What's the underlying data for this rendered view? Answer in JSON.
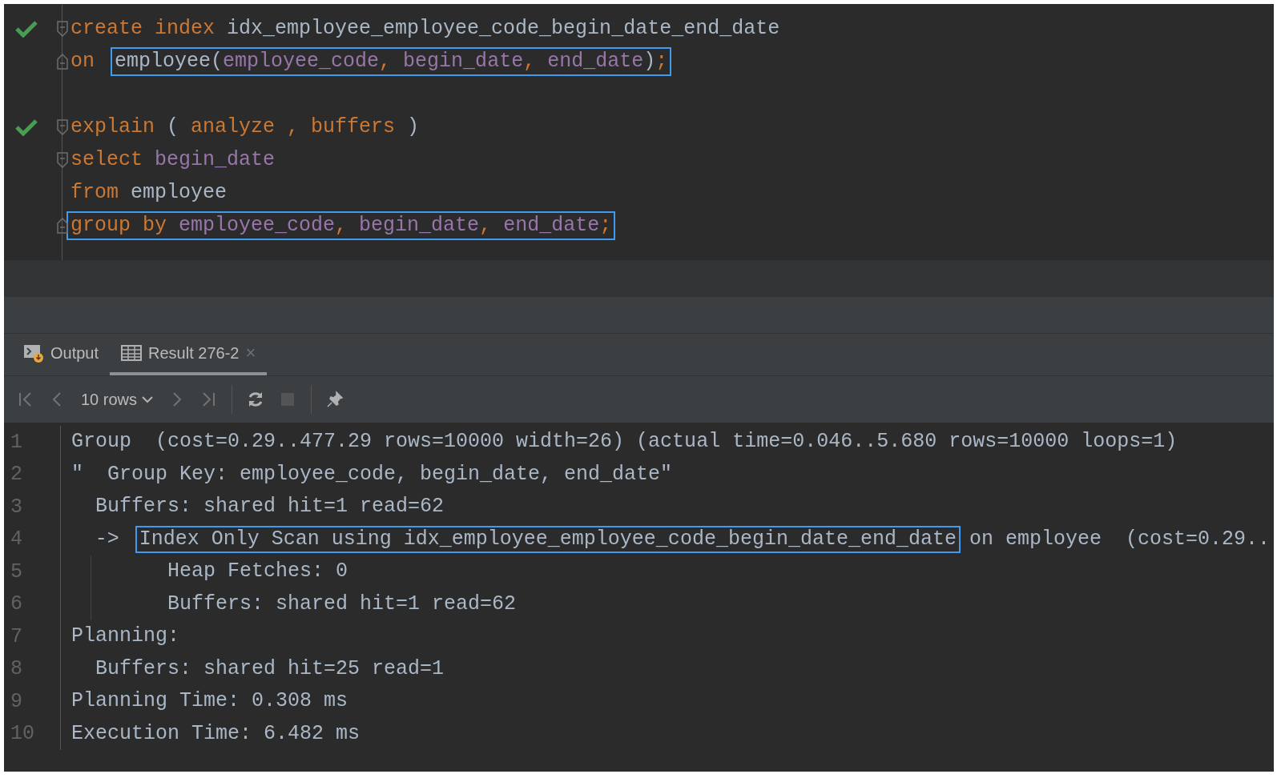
{
  "editor": {
    "lines": [
      {
        "check": true,
        "kind": "fold-start",
        "segments": [
          {
            "highlighted": false,
            "tokens": [
              {
                "kind": "keyword",
                "text": "create index "
              },
              {
                "kind": "name",
                "text": "idx_employee_employee_code_begin_date_end_date"
              }
            ]
          }
        ]
      },
      {
        "check": false,
        "kind": "fold-end",
        "segments": [
          {
            "highlighted": false,
            "tokens": [
              {
                "kind": "keyword",
                "text": "on "
              }
            ]
          },
          {
            "highlighted": true,
            "tokens": [
              {
                "kind": "name",
                "text": "employee("
              },
              {
                "kind": "column",
                "text": "employee_code"
              },
              {
                "kind": "keyword",
                "text": ", "
              },
              {
                "kind": "column",
                "text": "begin_date"
              },
              {
                "kind": "keyword",
                "text": ", "
              },
              {
                "kind": "column",
                "text": "end_date"
              },
              {
                "kind": "name",
                "text": ")"
              },
              {
                "kind": "keyword",
                "text": ";"
              }
            ]
          }
        ]
      },
      {
        "check": false,
        "kind": "plain"
      },
      {
        "check": true,
        "kind": "fold-start",
        "segments": [
          {
            "highlighted": false,
            "tokens": [
              {
                "kind": "keyword",
                "text": "explain "
              },
              {
                "kind": "name",
                "text": "( "
              },
              {
                "kind": "keyword",
                "text": "analyze , buffers "
              },
              {
                "kind": "name",
                "text": ")"
              }
            ]
          }
        ]
      },
      {
        "check": false,
        "kind": "fold-start",
        "segments": [
          {
            "highlighted": false,
            "tokens": [
              {
                "kind": "keyword",
                "text": "select "
              },
              {
                "kind": "column",
                "text": "begin_date"
              }
            ]
          }
        ]
      },
      {
        "check": false,
        "kind": "plain",
        "segments": [
          {
            "highlighted": false,
            "tokens": [
              {
                "kind": "keyword",
                "text": "from "
              },
              {
                "kind": "name",
                "text": "employee"
              }
            ]
          }
        ]
      },
      {
        "check": false,
        "kind": "fold-end",
        "segments": [
          {
            "highlighted": true,
            "tokens": [
              {
                "kind": "keyword",
                "text": "group by "
              },
              {
                "kind": "column",
                "text": "employee_code"
              },
              {
                "kind": "keyword",
                "text": ", "
              },
              {
                "kind": "column",
                "text": "begin_date"
              },
              {
                "kind": "keyword",
                "text": ", "
              },
              {
                "kind": "column",
                "text": "end_date"
              },
              {
                "kind": "keyword",
                "text": ";"
              }
            ]
          }
        ]
      }
    ]
  },
  "tabs": [
    {
      "label": "Output",
      "kind": "output",
      "selected": false
    },
    {
      "label": "Result 276-2",
      "kind": "result",
      "selected": true,
      "close": "×"
    }
  ],
  "toolbar": [
    {
      "kind": "first",
      "disabled": true
    },
    {
      "kind": "prev",
      "disabled": true
    },
    {
      "kind": "rows",
      "label": "10 rows",
      "disabled": false
    },
    {
      "kind": "next",
      "disabled": true
    },
    {
      "kind": "last",
      "disabled": true
    },
    {
      "kind": "separator"
    },
    {
      "kind": "refresh",
      "disabled": false
    },
    {
      "kind": "stop",
      "disabled": true
    },
    {
      "kind": "separator"
    },
    {
      "kind": "pin",
      "disabled": false
    }
  ],
  "results": {
    "rows": [
      {
        "number": "1",
        "guide": false,
        "segments": [
          {
            "highlighted": false,
            "text": "Group  (cost=0.29..477.29 rows=10000 width=26) (actual time=0.046..5.680 rows=10000 loops=1)"
          }
        ]
      },
      {
        "number": "2",
        "guide": false,
        "segments": [
          {
            "highlighted": false,
            "text": "\"  Group Key: employee_code, begin_date, end_date\""
          }
        ]
      },
      {
        "number": "3",
        "guide": false,
        "segments": [
          {
            "highlighted": false,
            "text": "  Buffers: shared hit=1 read=62"
          }
        ]
      },
      {
        "number": "4",
        "guide": false,
        "segments": [
          {
            "highlighted": false,
            "text": "  -> "
          },
          {
            "highlighted": true,
            "text": "Index Only Scan using idx_employee_employee_code_begin_date_end_date"
          },
          {
            "highlighted": false,
            "text": "on employee  (cost=0.29.."
          }
        ]
      },
      {
        "number": "5",
        "guide": true,
        "segments": [
          {
            "highlighted": false,
            "text": "        Heap Fetches: 0"
          }
        ]
      },
      {
        "number": "6",
        "guide": true,
        "segments": [
          {
            "highlighted": false,
            "text": "        Buffers: shared hit=1 read=62"
          }
        ]
      },
      {
        "number": "7",
        "guide": false,
        "segments": [
          {
            "highlighted": false,
            "text": "Planning:"
          }
        ]
      },
      {
        "number": "8",
        "guide": false,
        "segments": [
          {
            "highlighted": false,
            "text": "  Buffers: shared hit=25 read=1"
          }
        ]
      },
      {
        "number": "9",
        "guide": false,
        "segments": [
          {
            "highlighted": false,
            "text": "Planning Time: 0.308 ms"
          }
        ]
      },
      {
        "number": "10",
        "guide": false,
        "segments": [
          {
            "highlighted": false,
            "text": "Execution Time: 6.482 ms"
          }
        ]
      }
    ]
  }
}
